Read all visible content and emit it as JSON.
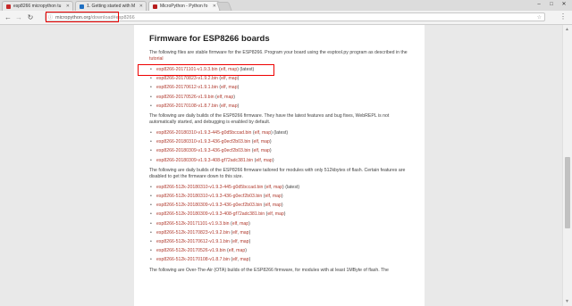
{
  "tabs": [
    {
      "title": "esp8266 micropython tu"
    },
    {
      "title": "1. Getting started with M"
    },
    {
      "title": "MicroPython - Python fo"
    }
  ],
  "address_bar": {
    "host": "micropython.org",
    "path": "/download#esp8266"
  },
  "page": {
    "heading": "Firmware for ESP8266 boards",
    "intro_1": "The following files are stable firmware for the ESP8266. Program your board using the esptool.py program as described in the ",
    "tutorial_link": "tutorial",
    "stable_files": [
      {
        "file": "esp8266-20171101-v1.9.3.bin",
        "suffix": " (latest)"
      },
      {
        "file": "esp8266-20170823-v1.9.2.bin",
        "suffix": ""
      },
      {
        "file": "esp8266-20170612-v1.9.1.bin",
        "suffix": ""
      },
      {
        "file": "esp8266-20170526-v1.9.bin",
        "suffix": ""
      },
      {
        "file": "esp8266-20170108-v1.8.7.bin",
        "suffix": ""
      }
    ],
    "intro_2": "The following are daily builds of the ESP8266 firmware. They have the latest features and bug fixes, WebREPL is not automatically started, and debugging is enabled by default.",
    "daily_files": [
      {
        "file": "esp8266-20180310-v1.9.3-445-g0d5bccad.bin",
        "suffix": " (latest)"
      },
      {
        "file": "esp8266-20180310-v1.9.3-436-g0ecf2b03.bin",
        "suffix": ""
      },
      {
        "file": "esp8266-20180309-v1.9.3-436-g0ecf2b03.bin",
        "suffix": ""
      },
      {
        "file": "esp8266-20180309-v1.9.3-408-gf72adc381.bin",
        "suffix": ""
      }
    ],
    "intro_3": "The following are daily builds of the ESP8266 firmware tailored for modules with only 512kbytes of flash. Certain features are disabled to get the firmware down to this size.",
    "small_files": [
      {
        "file": "esp8266-512k-20180310-v1.9.3-445-g0d5bccad.bin",
        "suffix": " (latest)"
      },
      {
        "file": "esp8266-512k-20180310-v1.9.3-436-g0ecf2b03.bin",
        "suffix": ""
      },
      {
        "file": "esp8266-512k-20180309-v1.9.3-436-g0ecf2b03.bin",
        "suffix": ""
      },
      {
        "file": "esp8266-512k-20180309-v1.9.3-408-gf72adc381.bin",
        "suffix": ""
      },
      {
        "file": "esp8266-512k-20171101-v1.9.3.bin",
        "suffix": ""
      },
      {
        "file": "esp8266-512k-20170823-v1.9.2.bin",
        "suffix": ""
      },
      {
        "file": "esp8266-512k-20170612-v1.9.1.bin",
        "suffix": ""
      },
      {
        "file": "esp8266-512k-20170526-v1.9.bin",
        "suffix": ""
      },
      {
        "file": "esp8266-512k-20170108-v1.8.7.bin",
        "suffix": ""
      }
    ],
    "intro_4": "The following are Over-The-Air (OTA) builds of the ESP8266 firmware, for modules with at least 1MByte of flash. The",
    "elf_label": "elf",
    "map_label": "map"
  },
  "colors": {
    "link": "#b03a2e",
    "highlight": "#ee0000"
  }
}
